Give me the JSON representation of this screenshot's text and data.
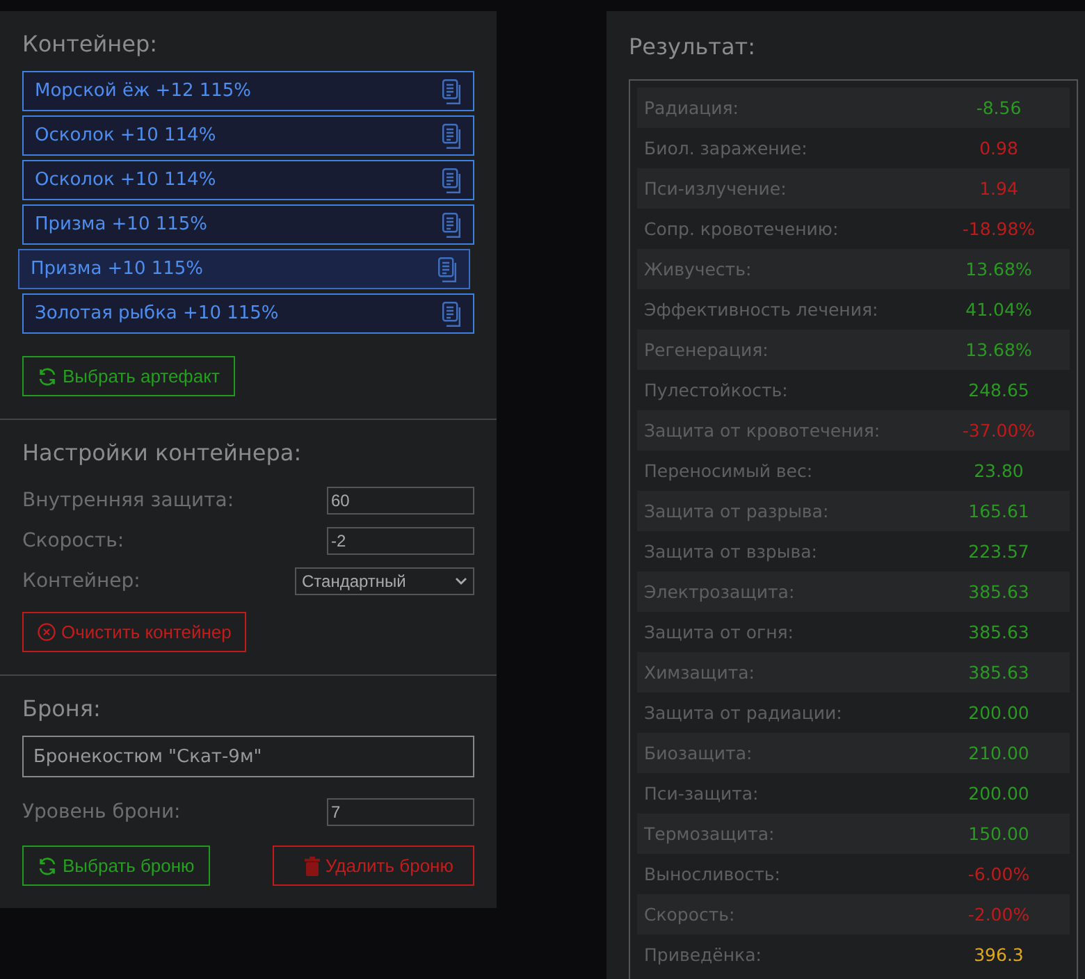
{
  "container": {
    "title": "Контейнер:",
    "artifacts": [
      {
        "name": "Морской ёж +12 115%",
        "selected": false
      },
      {
        "name": "Осколок +10 114%",
        "selected": false
      },
      {
        "name": "Осколок +10 114%",
        "selected": false
      },
      {
        "name": "Призма +10 115%",
        "selected": false
      },
      {
        "name": "Призма +10 115%",
        "selected": true
      },
      {
        "name": "Золотая рыбка +10 115%",
        "selected": false
      }
    ],
    "select_button": "Выбрать артефакт"
  },
  "settings": {
    "title": "Настройки контейнера:",
    "fields": [
      {
        "kind": "input",
        "label": "Внутренняя защита:",
        "value": "60"
      },
      {
        "kind": "input",
        "label": "Скорость:",
        "value": "-2"
      },
      {
        "kind": "select",
        "label": "Контейнер:",
        "value": "Стандартный"
      }
    ],
    "clear_button": "Очистить контейнер"
  },
  "armor": {
    "title": "Броня:",
    "name": "Бронекостюм \"Скат-9м\"",
    "level_label": "Уровень брони:",
    "level_value": "7",
    "select_button": "Выбрать броню",
    "delete_button": "Удалить броню"
  },
  "result": {
    "title": "Результат:",
    "rows": [
      {
        "label": "Радиация:",
        "value": "-8.56",
        "color": "#2a9a22"
      },
      {
        "label": "Биол. заражение:",
        "value": "0.98",
        "color": "#c01a1a"
      },
      {
        "label": "Пси-излучение:",
        "value": "1.94",
        "color": "#c01a1a"
      },
      {
        "label": "Сопр. кровотечению:",
        "value": "-18.98%",
        "color": "#c01a1a"
      },
      {
        "label": "Живучесть:",
        "value": "13.68%",
        "color": "#2a9a22"
      },
      {
        "label": "Эффективность лечения:",
        "value": "41.04%",
        "color": "#2a9a22"
      },
      {
        "label": "Регенерация:",
        "value": "13.68%",
        "color": "#2a9a22"
      },
      {
        "label": "Пулестойкость:",
        "value": "248.65",
        "color": "#2a9a22"
      },
      {
        "label": "Защита от кровотечения:",
        "value": "-37.00%",
        "color": "#c01a1a"
      },
      {
        "label": "Переносимый вес:",
        "value": "23.80",
        "color": "#2a9a22"
      },
      {
        "label": "Защита от разрыва:",
        "value": "165.61",
        "color": "#2a9a22"
      },
      {
        "label": "Защита от взрыва:",
        "value": "223.57",
        "color": "#2a9a22"
      },
      {
        "label": "Электрозащита:",
        "value": "385.63",
        "color": "#2a9a22"
      },
      {
        "label": "Защита от огня:",
        "value": "385.63",
        "color": "#2a9a22"
      },
      {
        "label": "Химзащита:",
        "value": "385.63",
        "color": "#2a9a22"
      },
      {
        "label": "Защита от радиации:",
        "value": "200.00",
        "color": "#2a9a22"
      },
      {
        "label": "Биозащита:",
        "value": "210.00",
        "color": "#2a9a22"
      },
      {
        "label": "Пси-защита:",
        "value": "200.00",
        "color": "#2a9a22"
      },
      {
        "label": "Термозащита:",
        "value": "150.00",
        "color": "#2a9a22"
      },
      {
        "label": "Выносливость:",
        "value": "-6.00%",
        "color": "#c01a1a"
      },
      {
        "label": "Скорость:",
        "value": "-2.00%",
        "color": "#c01a1a"
      },
      {
        "label": "Приведёнка:",
        "value": "396.3",
        "color": "#e0a81c"
      }
    ]
  }
}
